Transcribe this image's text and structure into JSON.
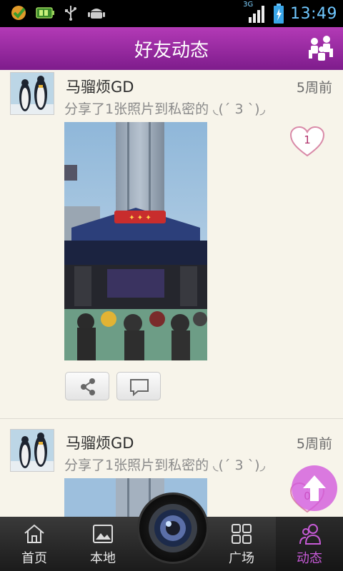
{
  "status_bar": {
    "time": "13:49",
    "network": "3G",
    "icons": [
      "app-icon",
      "battery-app-icon",
      "usb-icon",
      "android-icon",
      "signal-icon",
      "battery-icon"
    ]
  },
  "header": {
    "title": "好友动态",
    "friends_icon": "friends-icon"
  },
  "posts": [
    {
      "username": "马骝烦GD",
      "time_ago": "5周前",
      "description": "分享了1张照片到私密的 ◟(ˊ 3 ˋ)◞",
      "likes": "1",
      "actions": [
        "share-icon",
        "comment-icon"
      ]
    },
    {
      "username": "马骝烦GD",
      "time_ago": "5周前",
      "description": "分享了1张照片到私密的 ◟(ˊ 3 ˋ)◞",
      "likes": "0"
    }
  ],
  "tab_bar": {
    "tabs": [
      {
        "label": "首页",
        "icon": "home-icon"
      },
      {
        "label": "本地",
        "icon": "image-icon"
      },
      {
        "label": "广场",
        "icon": "grid-icon"
      },
      {
        "label": "动态",
        "icon": "people-icon",
        "active": true
      }
    ],
    "camera_icon": "camera-icon"
  },
  "colors": {
    "header": "#9a2aa6",
    "accent": "#c65ad6",
    "like": "#b0306a",
    "background": "#f7f4ea"
  }
}
